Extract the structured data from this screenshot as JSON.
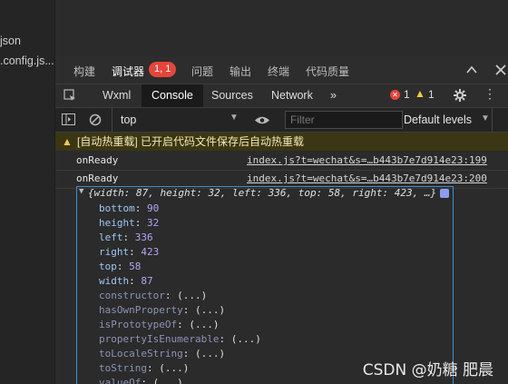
{
  "explorer": {
    "files": [
      "json",
      ".config.js..."
    ]
  },
  "devtools_tabs": [
    {
      "label": "构建"
    },
    {
      "label": "调试器"
    },
    {
      "label": "问题"
    },
    {
      "label": "输出"
    },
    {
      "label": "终端"
    },
    {
      "label": "代码质量"
    }
  ],
  "debugger_badge": "1, 1",
  "panel_tabs": [
    {
      "label": "Wxml"
    },
    {
      "label": "Console"
    },
    {
      "label": "Sources"
    },
    {
      "label": "Network"
    },
    {
      "label": "»"
    }
  ],
  "counts": {
    "errors": "1",
    "warnings": "1"
  },
  "toolbar": {
    "context": "top",
    "filter_placeholder": "Filter",
    "levels": "Default levels"
  },
  "warning": {
    "text": "[自动热重载] 已开启代码文件保存后自动热重载"
  },
  "logs": [
    {
      "message": "onReady",
      "source": "index.js?t=wechat&s=…b443b7e7d914e23:199"
    },
    {
      "message": "onReady",
      "source": "index.js?t=wechat&s=…b443b7e7d914e23:200"
    }
  ],
  "object_summary": "{width: 87, height: 32, left: 336, top: 58, right: 423, …}",
  "object_props": [
    {
      "key": "bottom",
      "value": "90",
      "dim": false
    },
    {
      "key": "height",
      "value": "32",
      "dim": false
    },
    {
      "key": "left",
      "value": "336",
      "dim": false
    },
    {
      "key": "right",
      "value": "423",
      "dim": false
    },
    {
      "key": "top",
      "value": "58",
      "dim": false
    },
    {
      "key": "width",
      "value": "87",
      "dim": false
    },
    {
      "key": "constructor",
      "value": "(...)",
      "dim": true
    },
    {
      "key": "hasOwnProperty",
      "value": "(...)",
      "dim": true
    },
    {
      "key": "isPrototypeOf",
      "value": "(...)",
      "dim": true
    },
    {
      "key": "propertyIsEnumerable",
      "value": "(...)",
      "dim": true
    },
    {
      "key": "toLocaleString",
      "value": "(...)",
      "dim": true
    },
    {
      "key": "toString",
      "value": "(...)",
      "dim": true
    },
    {
      "key": "valueOf",
      "value": "(...)",
      "dim": true
    }
  ],
  "watermark": "CSDN @奶糖 肥晨"
}
